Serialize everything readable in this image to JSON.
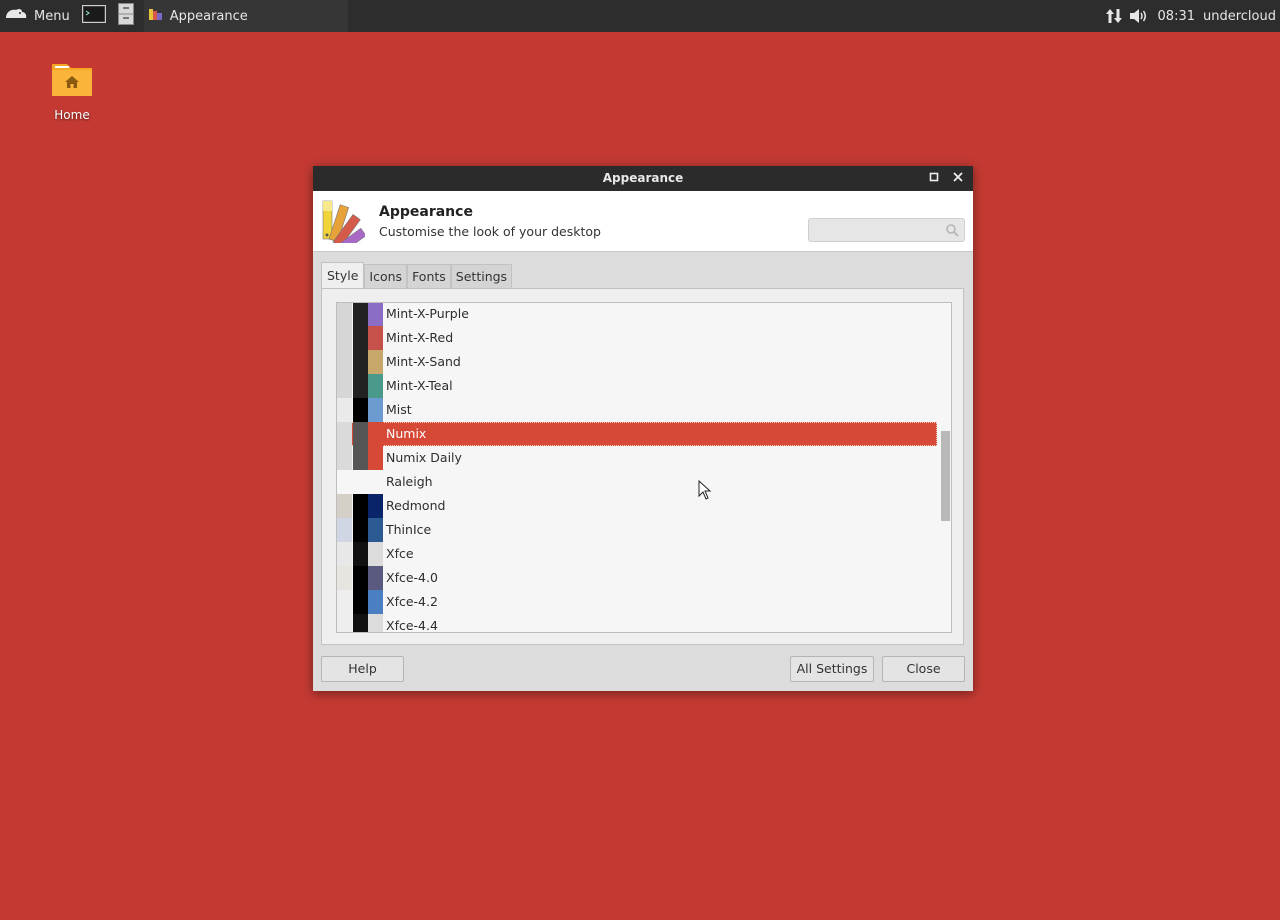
{
  "panel": {
    "menu_label": "Menu",
    "task_label": "Appearance",
    "clock": "08:31",
    "user": "undercloud"
  },
  "desktop": {
    "home_label": "Home",
    "background_color": "#c43a33"
  },
  "dialog": {
    "window_title": "Appearance",
    "header_title": "Appearance",
    "header_subtitle": "Customise the look of your desktop",
    "search_placeholder": "",
    "tabs": [
      {
        "label": "Style",
        "active": true
      },
      {
        "label": "Icons",
        "active": false
      },
      {
        "label": "Fonts",
        "active": false
      },
      {
        "label": "Settings",
        "active": false
      }
    ],
    "themes": [
      {
        "name": "Mint-X-Purple",
        "colors": [
          "#d6d6d6",
          "#222222",
          "#8c6dc6"
        ],
        "selected": false
      },
      {
        "name": "Mint-X-Red",
        "colors": [
          "#d6d6d6",
          "#222222",
          "#c5514a"
        ],
        "selected": false
      },
      {
        "name": "Mint-X-Sand",
        "colors": [
          "#d6d6d6",
          "#222222",
          "#c8a86a"
        ],
        "selected": false
      },
      {
        "name": "Mint-X-Teal",
        "colors": [
          "#d6d6d6",
          "#222222",
          "#4a9a8c"
        ],
        "selected": false
      },
      {
        "name": "Mist",
        "colors": [
          "#eaeaea",
          "#000000",
          "#6c9bd2"
        ],
        "selected": false
      },
      {
        "name": "Numix",
        "colors": [
          "#dadada",
          "#555555",
          "#d64937"
        ],
        "selected": true
      },
      {
        "name": "Numix Daily",
        "colors": [
          "#dadada",
          "#555555",
          "#d64937"
        ],
        "selected": false
      },
      {
        "name": "Raleigh",
        "colors": [
          "",
          "",
          ""
        ],
        "selected": false
      },
      {
        "name": "Redmond",
        "colors": [
          "#d4d0c8",
          "#000000",
          "#0a246a"
        ],
        "selected": false
      },
      {
        "name": "ThinIce",
        "colors": [
          "#d0d6e4",
          "#000000",
          "#2c5b94"
        ],
        "selected": false
      },
      {
        "name": "Xfce",
        "colors": [
          "#e8e8e8",
          "#111111",
          "#dcdcdc"
        ],
        "selected": false
      },
      {
        "name": "Xfce-4.0",
        "colors": [
          "#e8e4e0",
          "#000000",
          "#5a5a80"
        ],
        "selected": false
      },
      {
        "name": "Xfce-4.2",
        "colors": [
          "#eeeeee",
          "#000000",
          "#4a7fc2"
        ],
        "selected": false
      },
      {
        "name": "Xfce-4.4",
        "colors": [
          "#eeeeee",
          "#111111",
          "#dcdcdc"
        ],
        "selected": false
      }
    ],
    "buttons": {
      "help": "Help",
      "all_settings": "All Settings",
      "close": "Close"
    }
  }
}
